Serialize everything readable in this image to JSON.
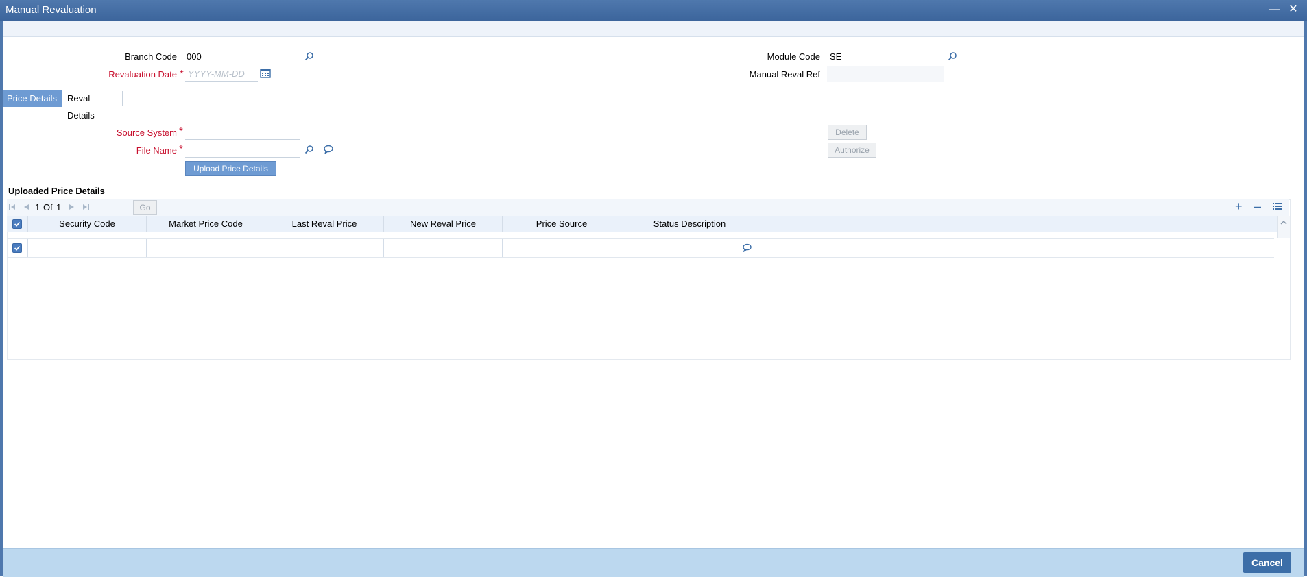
{
  "window": {
    "title": "Manual Revaluation"
  },
  "form": {
    "branch_code": {
      "label": "Branch Code",
      "value": "000"
    },
    "revaluation_date": {
      "label": "Revaluation Date",
      "required_mark": "*",
      "placeholder": "YYYY-MM-DD"
    },
    "module_code": {
      "label": "Module Code",
      "value": "SE"
    },
    "manual_reval_ref": {
      "label": "Manual Reval Ref",
      "value": ""
    }
  },
  "tabs": [
    {
      "label": "Price Details",
      "active": true
    },
    {
      "label": "Reval Details",
      "active": false
    }
  ],
  "price_details": {
    "source_system": {
      "label": "Source System",
      "required_mark": "*",
      "value": ""
    },
    "file_name": {
      "label": "File Name",
      "required_mark": "*",
      "value": ""
    },
    "upload_button": "Upload Price Details",
    "delete_button": "Delete",
    "authorize_button": "Authorize"
  },
  "grid": {
    "title": "Uploaded Price Details",
    "pager": {
      "current": "1",
      "of_label": "Of",
      "total": "1",
      "go_label": "Go"
    },
    "columns": [
      "Security Code",
      "Market Price Code",
      "Last Reval Price",
      "New Reval Price",
      "Price Source",
      "Status Description"
    ],
    "rows": [
      {
        "security_code": "",
        "market_price_code": "",
        "last_reval_price": "",
        "new_reval_price": "",
        "price_source": "",
        "status_description": ""
      }
    ]
  },
  "footer": {
    "cancel_label": "Cancel"
  },
  "colors": {
    "title_bar": "#3c659c",
    "tab_active": "#6e9bd3",
    "required": "#c8102e",
    "footer": "#bcd8ef"
  }
}
